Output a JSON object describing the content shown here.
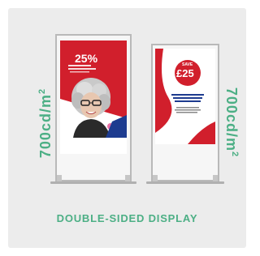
{
  "left_badge": {
    "value": "700cd/m",
    "superscript": "2"
  },
  "right_badge": {
    "value": "700cd/m",
    "superscript": "2"
  },
  "left_ad": {
    "headline": "25%"
  },
  "right_ad": {
    "headline": "SAVE",
    "amount": "£25"
  },
  "caption": "DOUBLE-SIDED DISPLAY",
  "colors": {
    "accent_green": "#4caf85",
    "ad_red": "#d11f2c",
    "card_bg": "#ececec"
  }
}
